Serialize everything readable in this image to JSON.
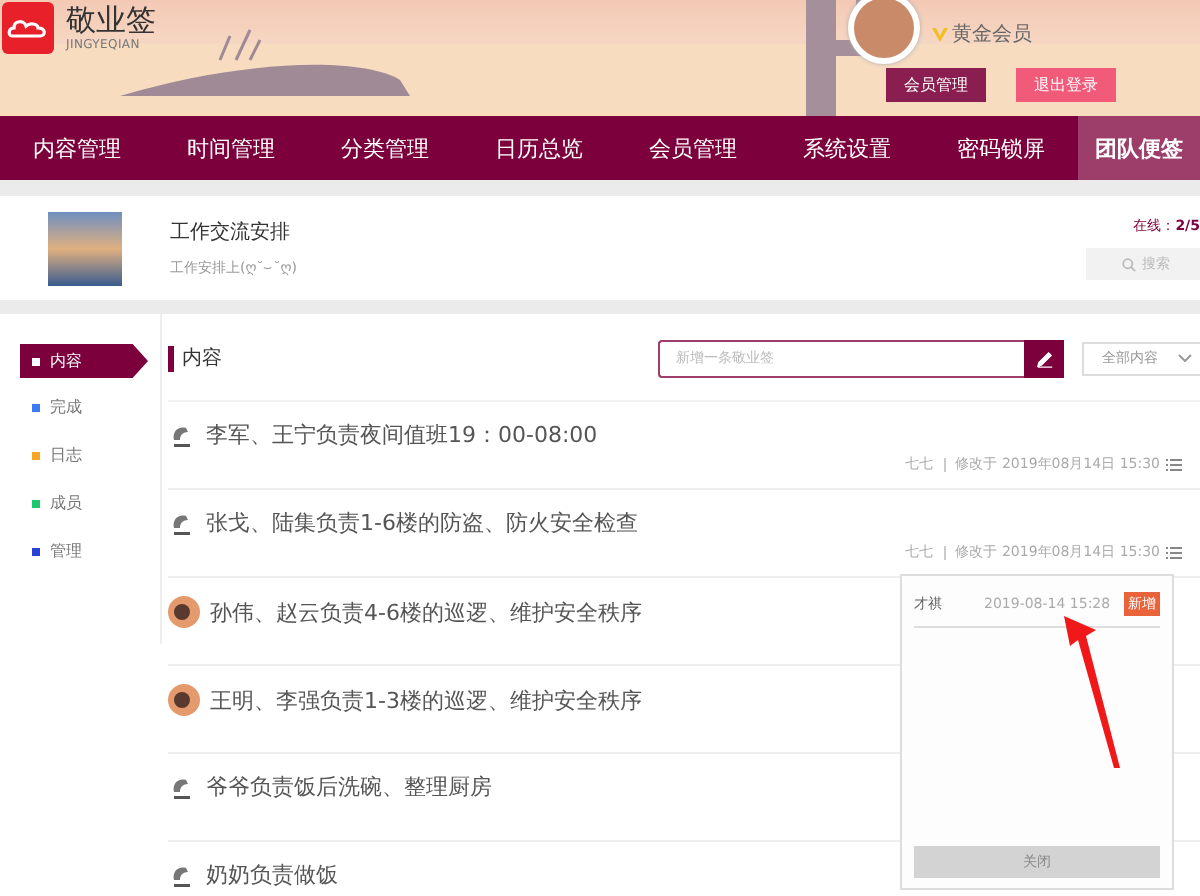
{
  "brand": {
    "name": "敬业签",
    "subtitle": "JINGYEQIAN"
  },
  "user": {
    "level": "黄金会员",
    "buttons": [
      {
        "label": "会员管理",
        "kind": "primary"
      },
      {
        "label": "退出登录",
        "kind": "danger"
      }
    ]
  },
  "nav": [
    {
      "label": "内容管理",
      "selected": false
    },
    {
      "label": "时间管理",
      "selected": false
    },
    {
      "label": "分类管理",
      "selected": false
    },
    {
      "label": "日历总览",
      "selected": false
    },
    {
      "label": "会员管理",
      "selected": false
    },
    {
      "label": "系统设置",
      "selected": false
    },
    {
      "label": "密码锁屏",
      "selected": false
    },
    {
      "label": "团队便签",
      "selected": true
    }
  ],
  "group": {
    "title": "工作交流安排",
    "description": "工作安排上(ღ˘⌣˘ღ)",
    "online_label": "在线：",
    "online_count": "2/5",
    "search_button": "搜索"
  },
  "sidebar": [
    {
      "label": "内容",
      "selected": true,
      "color": "#ffffff"
    },
    {
      "label": "完成",
      "selected": false,
      "color": "#3d7bf0"
    },
    {
      "label": "日志",
      "selected": false,
      "color": "#f5a623"
    },
    {
      "label": "成员",
      "selected": false,
      "color": "#1ec86e"
    },
    {
      "label": "管理",
      "selected": false,
      "color": "#2a3fd6"
    }
  ],
  "content": {
    "heading": "内容",
    "new_note": {
      "placeholder": "新增一条敬业签"
    },
    "filter": {
      "value": "全部内容"
    }
  },
  "notes": [
    {
      "kind": "figure",
      "text": "李军、王宁负责夜间值班19：00-08:00",
      "author": "七七",
      "modified": "修改于 2019年08月14日 15:30"
    },
    {
      "kind": "figure",
      "text": "张戈、陆集负责1-6楼的防盗、防火安全检查",
      "author": "七七",
      "modified": "修改于 2019年08月14日 15:30"
    },
    {
      "kind": "photo",
      "text": "孙伟、赵云负责4-6楼的巡逻、维护安全秩序"
    },
    {
      "kind": "photo",
      "text": "王明、李强负责1-3楼的巡逻、维护安全秩序"
    },
    {
      "kind": "figure",
      "text": "爷爷负责饭后洗碗、整理厨房"
    },
    {
      "kind": "figure",
      "text": "奶奶负责做饭"
    }
  ],
  "history_popup": {
    "entries": [
      {
        "user": "才祺",
        "time": "2019-08-14 15:28",
        "action": "新增"
      }
    ],
    "close_button": "关闭"
  }
}
